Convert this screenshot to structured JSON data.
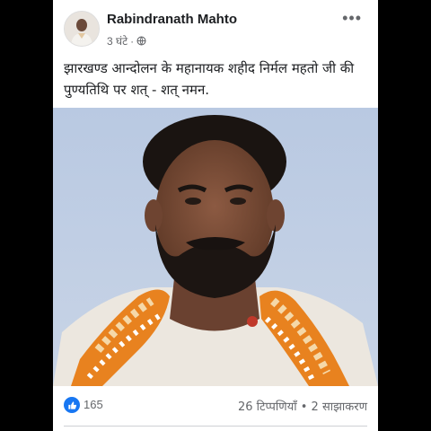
{
  "post": {
    "author": "Rabindranath Mahto",
    "time": "3 घंटे",
    "separator": "·",
    "privacy_icon": "globe-icon",
    "more_icon": "more-options-icon",
    "more_label": "•••",
    "text": "झारखण्ड आन्दोलन के महानायक शहीद निर्मल महतो जी की पुण्यतिथि पर शत् - शत्  नमन."
  },
  "footer": {
    "reaction_icon": "like-icon",
    "reactions": "165",
    "stats": "26 टिप्पणियाँ • 2 साझाकरण"
  },
  "colors": {
    "accent": "#1877f2",
    "muted_text": "#65676b",
    "text": "#1c1e21"
  }
}
